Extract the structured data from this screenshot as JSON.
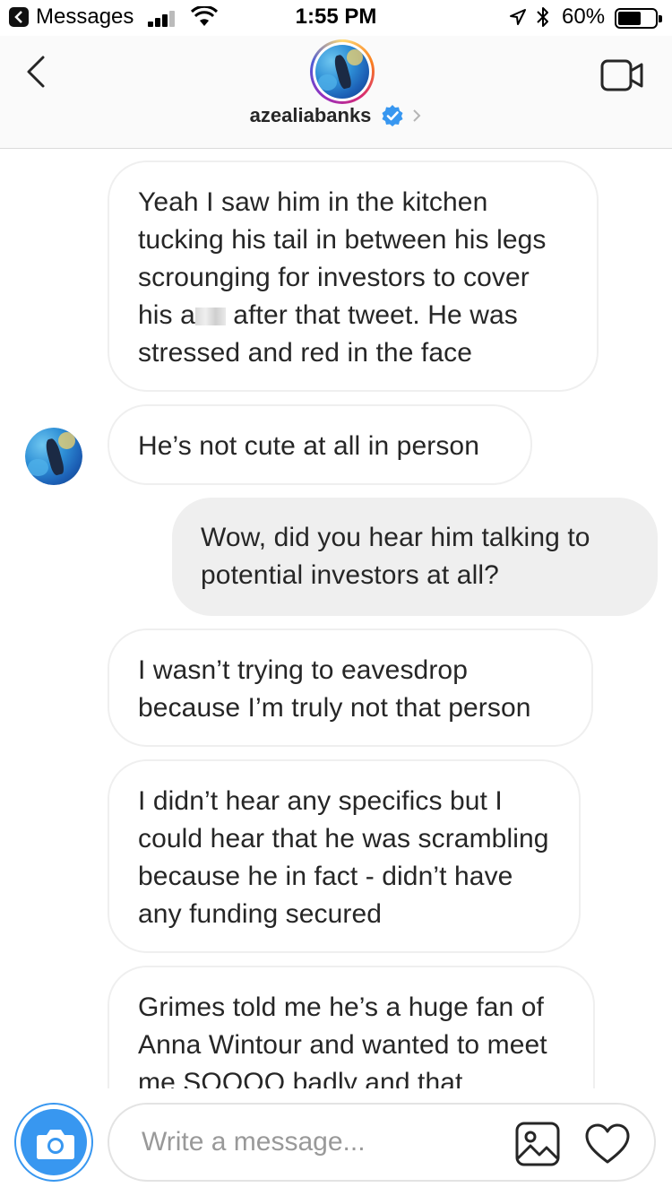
{
  "status_bar": {
    "back_app": "Messages",
    "time": "1:55 PM",
    "battery_percent": "60%",
    "battery_level": 0.6
  },
  "header": {
    "username": "azealiabanks",
    "verified": true,
    "icons": {
      "back": "chevron-left-icon",
      "video": "video-call-icon",
      "verified": "verified-badge-icon"
    }
  },
  "messages": [
    {
      "direction": "in",
      "text_before": "Yeah I saw him in the kitchen tucking his tail in between his legs scrounging for investors to cover his a",
      "text_after": " after that tweet. He was stressed and red in the face",
      "censored": true
    },
    {
      "direction": "in",
      "text": "He’s not cute at all in person"
    },
    {
      "direction": "out",
      "text": "Wow, did you hear him talking to potential investors at all?"
    },
    {
      "direction": "in",
      "text": "I wasn’t trying to eavesdrop because I’m truly not that person"
    },
    {
      "direction": "in",
      "text": "I didn’t hear any specifics but I could hear that he was scrambling because he in fact - didn’t have any funding secured"
    },
    {
      "direction": "in",
      "text": "Grimes told me he’s a huge fan of Anna Wintour and wanted to meet me SOOOO badly and that"
    }
  ],
  "composer": {
    "placeholder": "Write a message...",
    "value": "",
    "icons": {
      "camera": "camera-icon",
      "gallery": "gallery-icon",
      "like": "heart-icon"
    }
  },
  "colors": {
    "accent_blue": "#3897f0",
    "bubble_out_bg": "#efefef",
    "bubble_in_border": "#efefef",
    "text": "#262626"
  }
}
